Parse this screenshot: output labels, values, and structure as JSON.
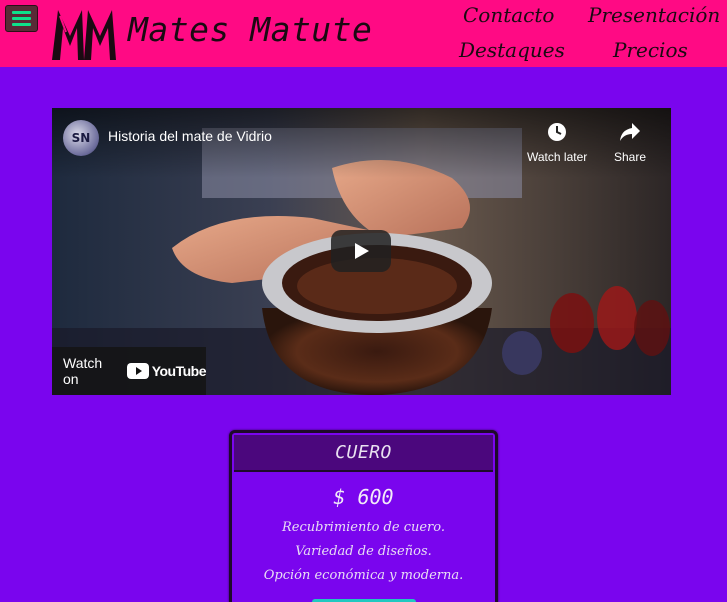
{
  "header": {
    "brand": "Mates Matute",
    "logo_text": "MM",
    "nav": {
      "contacto": "Contacto",
      "presentacion": "Presentación",
      "destaques": "Destaques",
      "precios": "Precios"
    }
  },
  "video": {
    "title": "Historia del mate de Vidrio",
    "channel_initials": "SN",
    "watch_later": "Watch later",
    "share": "Share",
    "watch_on": "Watch on",
    "youtube": "YouTube"
  },
  "pricing_card": {
    "title": "CUERO",
    "price": "$ 600",
    "features": [
      "Recubrimiento de cuero.",
      "Variedad de diseños.",
      "Opción económica y moderna."
    ]
  },
  "colors": {
    "background": "#7a05ee",
    "header": "#ff0a84",
    "card_header": "#4b077d",
    "menu_icon": "#0ee28a",
    "button": "#20c8c0"
  }
}
